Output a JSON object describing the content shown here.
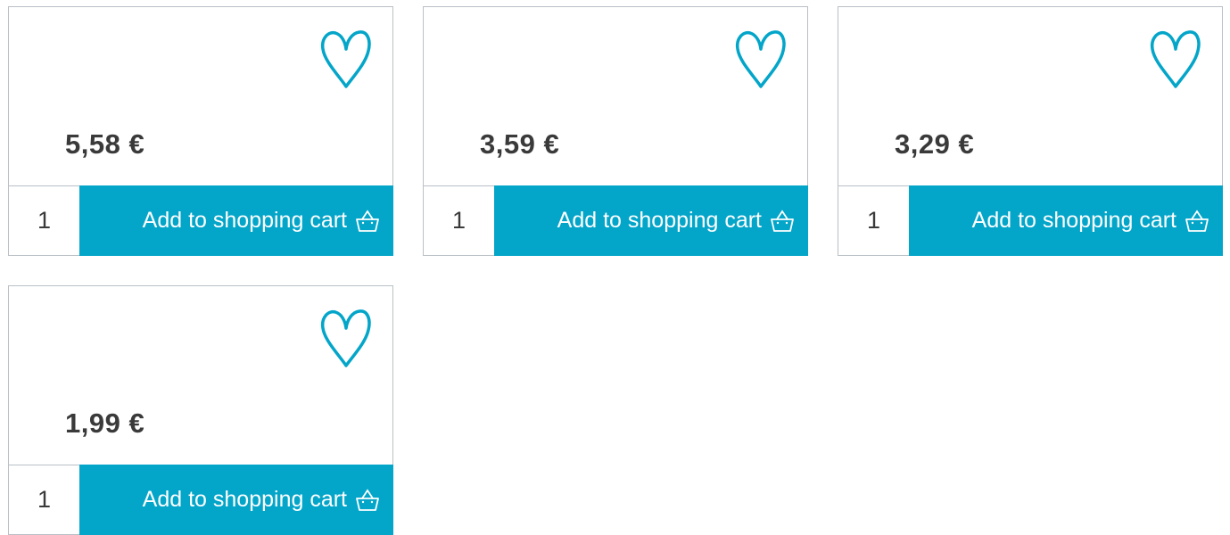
{
  "colors": {
    "accent": "#03a5c9",
    "border": "#b9c0c7",
    "text": "#3a3a3a",
    "button_text": "#ffffff"
  },
  "products": [
    {
      "price": "5,58 €",
      "quantity": "1",
      "add_label": "Add to shopping cart",
      "favorite_icon": "heart-icon",
      "cart_icon": "basket-icon"
    },
    {
      "price": "3,59 €",
      "quantity": "1",
      "add_label": "Add to shopping cart",
      "favorite_icon": "heart-icon",
      "cart_icon": "basket-icon"
    },
    {
      "price": "3,29 €",
      "quantity": "1",
      "add_label": "Add to shopping cart",
      "favorite_icon": "heart-icon",
      "cart_icon": "basket-icon"
    },
    {
      "price": "1,99 €",
      "quantity": "1",
      "add_label": "Add to shopping cart",
      "favorite_icon": "heart-icon",
      "cart_icon": "basket-icon"
    }
  ]
}
